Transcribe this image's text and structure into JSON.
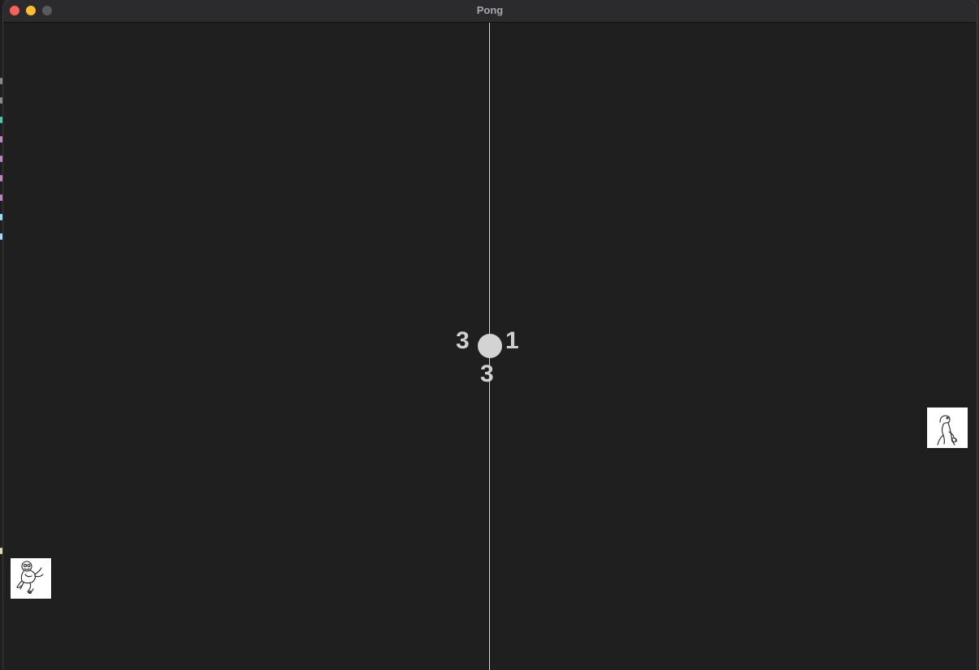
{
  "window": {
    "title": "Pong",
    "buttons": {
      "close_color": "#fe5f57",
      "minimize_color": "#febc2e",
      "maximize_color": "#5a5a5e"
    }
  },
  "game": {
    "scores": {
      "left": "3",
      "right": "1",
      "center": "3"
    },
    "colors": {
      "background": "#1f1f1f",
      "net": "#d8d8d8",
      "ball": "#d3d3d3",
      "score": "#cfcfcf",
      "paddle": "#ffffff"
    },
    "paddles": {
      "left_icon": "turtle-sketch-icon",
      "right_icon": "dinosaur-sketch-icon"
    }
  }
}
